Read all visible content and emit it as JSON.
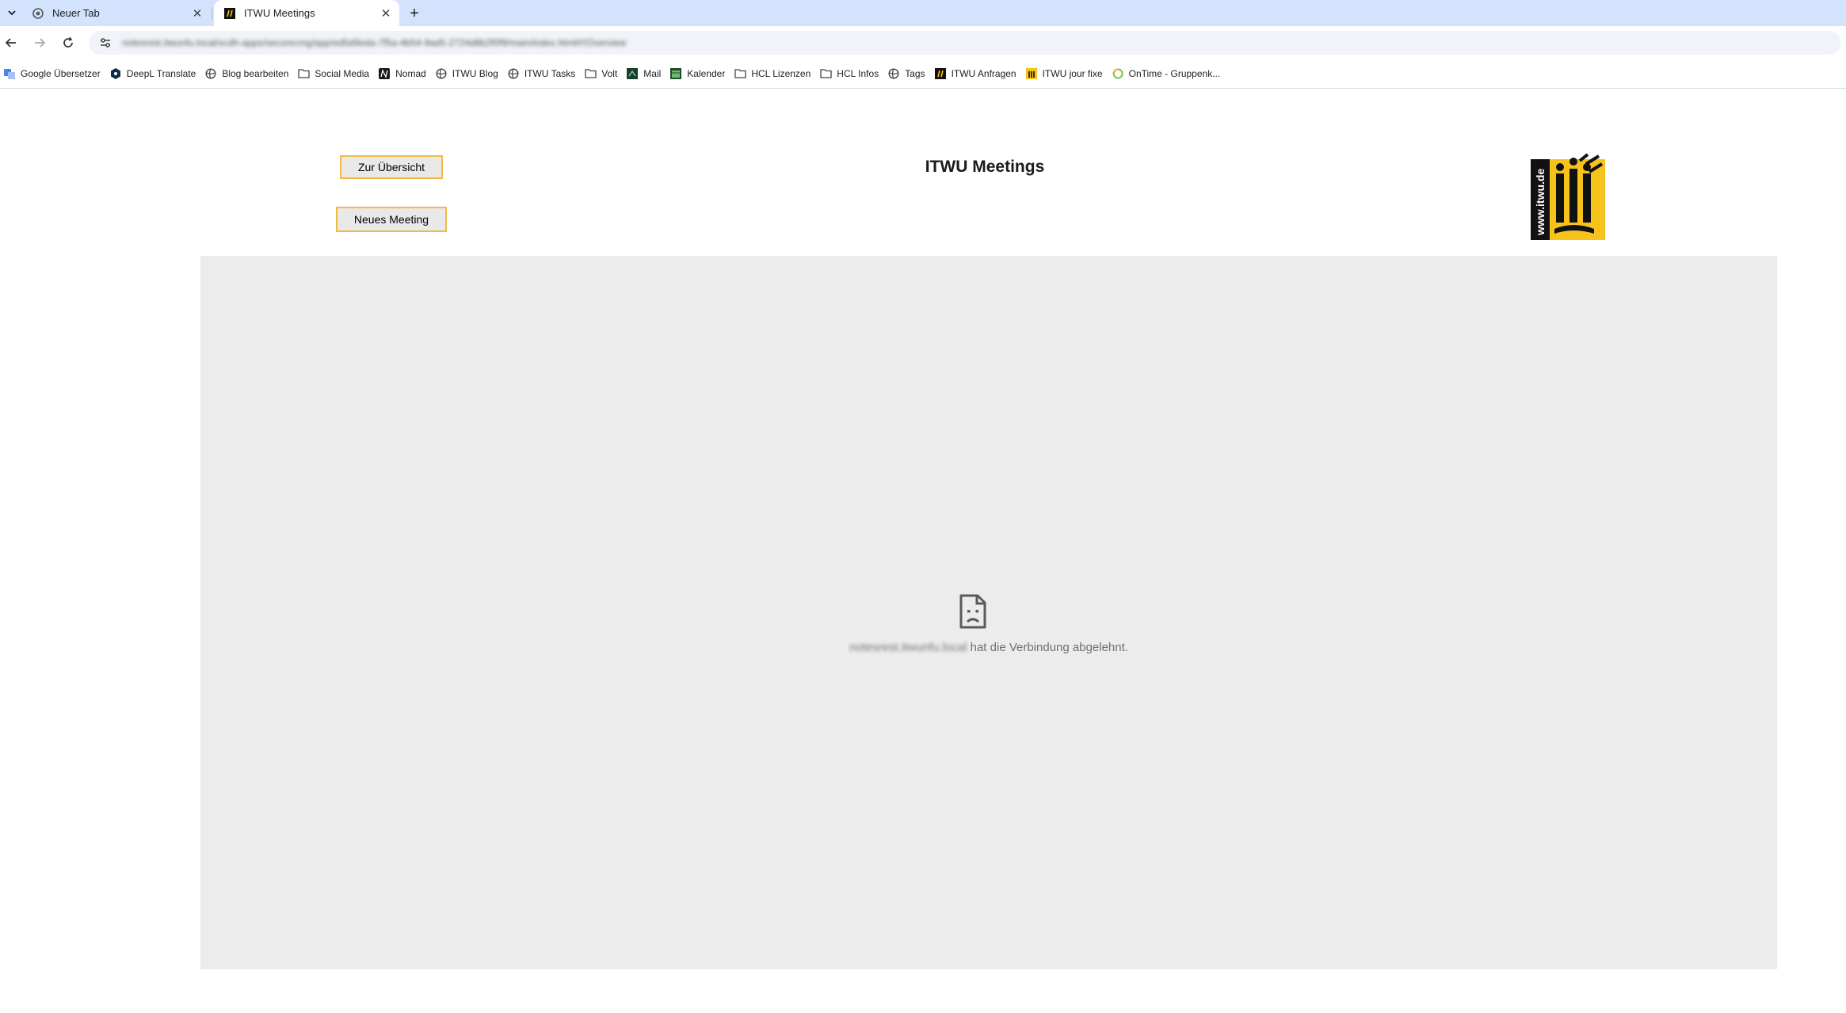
{
  "browser": {
    "tabs": [
      {
        "title": "Neuer Tab",
        "active": false,
        "icon": "chrome-icon"
      },
      {
        "title": "ITWU Meetings",
        "active": true,
        "icon": "itwu-favicon"
      }
    ],
    "new_tab_symbol": "+",
    "close_symbol": "✕",
    "url": "notesrest.itwunfu.local/xcdh-apps/securecmg/app/ed5d9eda-7f5a-4b54-9ad5-2724d8b2f0f9/main/index.html#!/Overview"
  },
  "bookmarks": [
    {
      "label": "Google Übersetzer",
      "icon": "translate-icon"
    },
    {
      "label": "DeepL Translate",
      "icon": "deepl-icon"
    },
    {
      "label": "Blog bearbeiten",
      "icon": "globe-icon"
    },
    {
      "label": "Social Media",
      "icon": "folder-icon"
    },
    {
      "label": "Nomad",
      "icon": "nomad-icon"
    },
    {
      "label": "ITWU Blog",
      "icon": "globe-icon"
    },
    {
      "label": "ITWU Tasks",
      "icon": "globe-icon"
    },
    {
      "label": "Volt",
      "icon": "folder-icon"
    },
    {
      "label": "Mail",
      "icon": "mail-icon"
    },
    {
      "label": "Kalender",
      "icon": "calendar-icon"
    },
    {
      "label": "HCL Lizenzen",
      "icon": "folder-icon"
    },
    {
      "label": "HCL Infos",
      "icon": "folder-icon"
    },
    {
      "label": "Tags",
      "icon": "globe-icon"
    },
    {
      "label": "ITWU Anfragen",
      "icon": "itwu-icon"
    },
    {
      "label": "ITWU jour fixe",
      "icon": "itwu-yellow-icon"
    },
    {
      "label": "OnTime - Gruppenk...",
      "icon": "ontime-icon"
    }
  ],
  "page": {
    "title": "ITWU Meetings",
    "overview_button": "Zur Übersicht",
    "new_meeting_button": "Neues Meeting",
    "logo_text": "www.itwu.de",
    "error_host": "notesrest.itwunfu.local",
    "error_message": " hat die Verbindung abgelehnt."
  },
  "colors": {
    "tabstrip": "#d3e3fd",
    "button_border": "#f4b942",
    "button_bg": "#e9e9e9",
    "frame_bg": "#ececec",
    "logo_yellow": "#f6c31c"
  }
}
